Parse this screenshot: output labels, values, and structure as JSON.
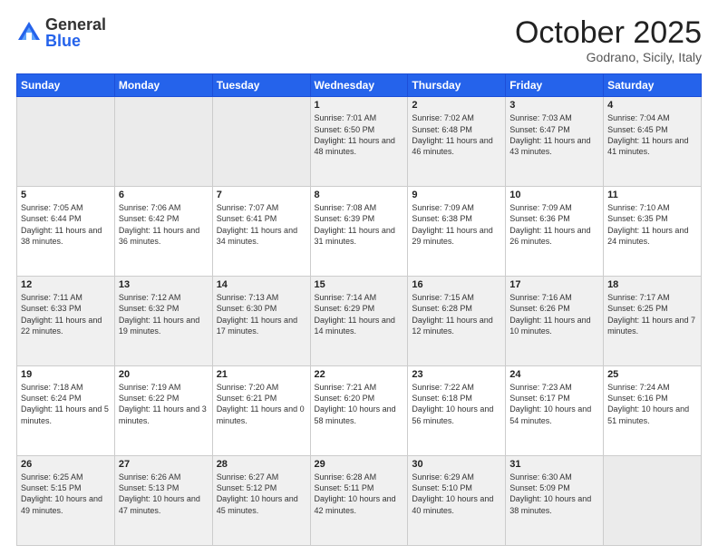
{
  "header": {
    "logo_general": "General",
    "logo_blue": "Blue",
    "month": "October 2025",
    "location": "Godrano, Sicily, Italy"
  },
  "weekdays": [
    "Sunday",
    "Monday",
    "Tuesday",
    "Wednesday",
    "Thursday",
    "Friday",
    "Saturday"
  ],
  "rows": [
    [
      {
        "day": "",
        "empty": true
      },
      {
        "day": "",
        "empty": true
      },
      {
        "day": "",
        "empty": true
      },
      {
        "day": "1",
        "sunrise": "7:01 AM",
        "sunset": "6:50 PM",
        "daylight": "11 hours and 48 minutes."
      },
      {
        "day": "2",
        "sunrise": "7:02 AM",
        "sunset": "6:48 PM",
        "daylight": "11 hours and 46 minutes."
      },
      {
        "day": "3",
        "sunrise": "7:03 AM",
        "sunset": "6:47 PM",
        "daylight": "11 hours and 43 minutes."
      },
      {
        "day": "4",
        "sunrise": "7:04 AM",
        "sunset": "6:45 PM",
        "daylight": "11 hours and 41 minutes."
      }
    ],
    [
      {
        "day": "5",
        "sunrise": "7:05 AM",
        "sunset": "6:44 PM",
        "daylight": "11 hours and 38 minutes."
      },
      {
        "day": "6",
        "sunrise": "7:06 AM",
        "sunset": "6:42 PM",
        "daylight": "11 hours and 36 minutes."
      },
      {
        "day": "7",
        "sunrise": "7:07 AM",
        "sunset": "6:41 PM",
        "daylight": "11 hours and 34 minutes."
      },
      {
        "day": "8",
        "sunrise": "7:08 AM",
        "sunset": "6:39 PM",
        "daylight": "11 hours and 31 minutes."
      },
      {
        "day": "9",
        "sunrise": "7:09 AM",
        "sunset": "6:38 PM",
        "daylight": "11 hours and 29 minutes."
      },
      {
        "day": "10",
        "sunrise": "7:09 AM",
        "sunset": "6:36 PM",
        "daylight": "11 hours and 26 minutes."
      },
      {
        "day": "11",
        "sunrise": "7:10 AM",
        "sunset": "6:35 PM",
        "daylight": "11 hours and 24 minutes."
      }
    ],
    [
      {
        "day": "12",
        "sunrise": "7:11 AM",
        "sunset": "6:33 PM",
        "daylight": "11 hours and 22 minutes."
      },
      {
        "day": "13",
        "sunrise": "7:12 AM",
        "sunset": "6:32 PM",
        "daylight": "11 hours and 19 minutes."
      },
      {
        "day": "14",
        "sunrise": "7:13 AM",
        "sunset": "6:30 PM",
        "daylight": "11 hours and 17 minutes."
      },
      {
        "day": "15",
        "sunrise": "7:14 AM",
        "sunset": "6:29 PM",
        "daylight": "11 hours and 14 minutes."
      },
      {
        "day": "16",
        "sunrise": "7:15 AM",
        "sunset": "6:28 PM",
        "daylight": "11 hours and 12 minutes."
      },
      {
        "day": "17",
        "sunrise": "7:16 AM",
        "sunset": "6:26 PM",
        "daylight": "11 hours and 10 minutes."
      },
      {
        "day": "18",
        "sunrise": "7:17 AM",
        "sunset": "6:25 PM",
        "daylight": "11 hours and 7 minutes."
      }
    ],
    [
      {
        "day": "19",
        "sunrise": "7:18 AM",
        "sunset": "6:24 PM",
        "daylight": "11 hours and 5 minutes."
      },
      {
        "day": "20",
        "sunrise": "7:19 AM",
        "sunset": "6:22 PM",
        "daylight": "11 hours and 3 minutes."
      },
      {
        "day": "21",
        "sunrise": "7:20 AM",
        "sunset": "6:21 PM",
        "daylight": "11 hours and 0 minutes."
      },
      {
        "day": "22",
        "sunrise": "7:21 AM",
        "sunset": "6:20 PM",
        "daylight": "10 hours and 58 minutes."
      },
      {
        "day": "23",
        "sunrise": "7:22 AM",
        "sunset": "6:18 PM",
        "daylight": "10 hours and 56 minutes."
      },
      {
        "day": "24",
        "sunrise": "7:23 AM",
        "sunset": "6:17 PM",
        "daylight": "10 hours and 54 minutes."
      },
      {
        "day": "25",
        "sunrise": "7:24 AM",
        "sunset": "6:16 PM",
        "daylight": "10 hours and 51 minutes."
      }
    ],
    [
      {
        "day": "26",
        "sunrise": "6:25 AM",
        "sunset": "5:15 PM",
        "daylight": "10 hours and 49 minutes."
      },
      {
        "day": "27",
        "sunrise": "6:26 AM",
        "sunset": "5:13 PM",
        "daylight": "10 hours and 47 minutes."
      },
      {
        "day": "28",
        "sunrise": "6:27 AM",
        "sunset": "5:12 PM",
        "daylight": "10 hours and 45 minutes."
      },
      {
        "day": "29",
        "sunrise": "6:28 AM",
        "sunset": "5:11 PM",
        "daylight": "10 hours and 42 minutes."
      },
      {
        "day": "30",
        "sunrise": "6:29 AM",
        "sunset": "5:10 PM",
        "daylight": "10 hours and 40 minutes."
      },
      {
        "day": "31",
        "sunrise": "6:30 AM",
        "sunset": "5:09 PM",
        "daylight": "10 hours and 38 minutes."
      },
      {
        "day": "",
        "empty": true
      }
    ]
  ]
}
